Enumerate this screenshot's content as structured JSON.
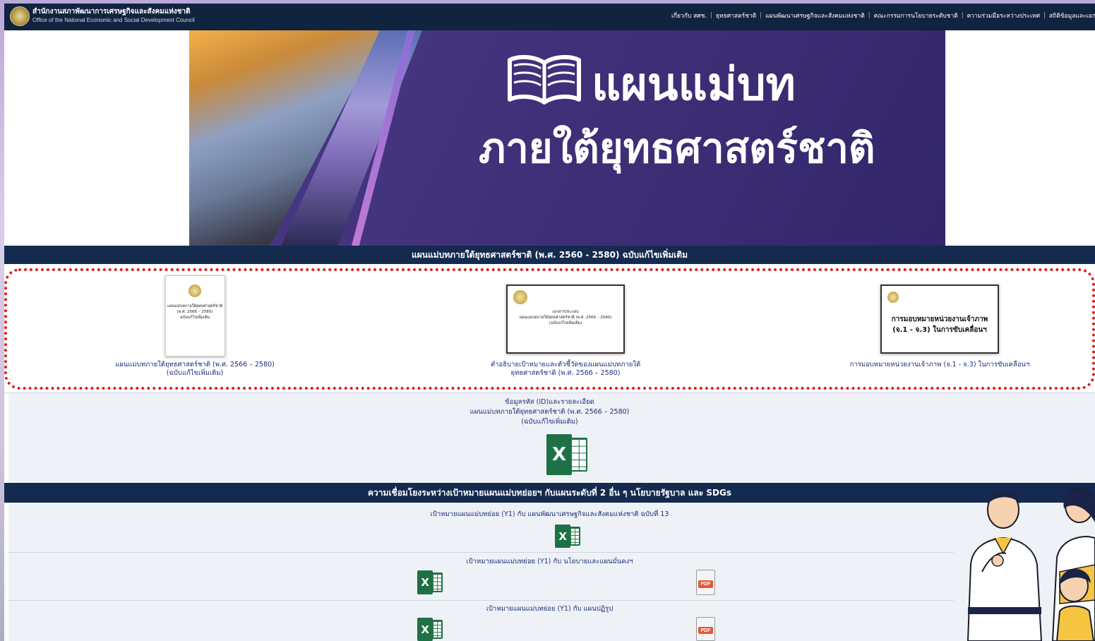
{
  "header": {
    "org_name_th": "สำนักงานสภาพัฒนาการเศรษฐกิจและสังคมแห่งชาติ",
    "org_name_en": "Office of the National Economic and Social Development Council",
    "nav": [
      "เกี่ยวกับ สศช.",
      "ยุทธศาสตร์ชาติ",
      "แผนพัฒนาเศรษฐกิจและสังคมแห่งชาติ",
      "คณะกรรมการนโยบายระดับชาติ",
      "ความร่วมมือระหว่างประเทศ",
      "สถิติข้อมูลและเอกสา"
    ]
  },
  "banner": {
    "line1": "แผนแม่บท",
    "line2": "ภายใต้ยุทธศาสตร์ชาติ"
  },
  "section1": {
    "title": "แผนแม่บทภายใต้ยุทธศาสตร์ชาติ (พ.ศ. 2560 - 2580) ฉบับแก้ไขเพิ่มเติม",
    "docs": [
      {
        "caption_line1": "แผนแม่บทภายใต้ยุทธศาสตร์ชาติ (พ.ศ. 2566 – 2580)",
        "caption_line2": "(ฉบับแก้ไขเพิ่มเติม)",
        "cover_text": "แผนแม่บทภายใต้ยุทธศาสตร์ชาติ",
        "cover_sub": "(พ.ศ. 2566 – 2580)",
        "cover_sub2": "ฉบับแก้ไขเพิ่มเติม"
      },
      {
        "caption_line1": "คำอธิบายเป้าหมายและตัวชี้วัดของแผนแม่บทภายใต้",
        "caption_line2": "ยุทธศาสตร์ชาติ (พ.ศ. 2566 – 2580)",
        "cover_text": "เอกสารประกอบ",
        "cover_sub": "แผนแม่บทภายใต้ยุทธศาสตร์ชาติ (พ.ศ. 2566 – 2580)",
        "cover_sub2": "(ฉบับแก้ไขเพิ่มเติม)"
      },
      {
        "caption_line1": "การมอบหมายหน่วยงานเจ้าภาพ (จ.1 - จ.3) ในการขับเคลื่อนฯ",
        "cover_title_l1": "การมอบหมายหน่วยงานเจ้าภาพ",
        "cover_title_l2": "(จ.1 - จ.3) ในการขับเคลื่อนฯ"
      }
    ]
  },
  "data_file": {
    "line1": "ข้อมูลรหัส (ID)และรายละเอียด",
    "line2": "แผนแม่บทภายใต้ยุทธศาสตร์ชาติ (พ.ศ. 2566 – 2580)",
    "line3": "(ฉบับแก้ไขเพิ่มเติม)",
    "icon_letter": "X"
  },
  "section2": {
    "title": "ความเชื่อมโยงระหว่างเป้าหมายแผนแม่บทย่อยฯ กับแผนระดับที่ 2 อื่น ๆ นโยบายรัฐบาล และ SDGs",
    "rows": [
      {
        "label": "เป้าหมายแผนแม่บทย่อย (Y1) กับ แผนพัฒนาเศรษฐกิจและสังคมแห่งชาติ ฉบับที่ 13"
      },
      {
        "label": "เป้าหมายแผนแม่บทย่อย (Y1) กับ นโยบายและแผนมั่นคงฯ"
      },
      {
        "label": "เป้าหมายแผนแม่บทย่อย (Y1) กับ แผนปฏิรูป"
      }
    ],
    "pdf_label": "PDF"
  }
}
